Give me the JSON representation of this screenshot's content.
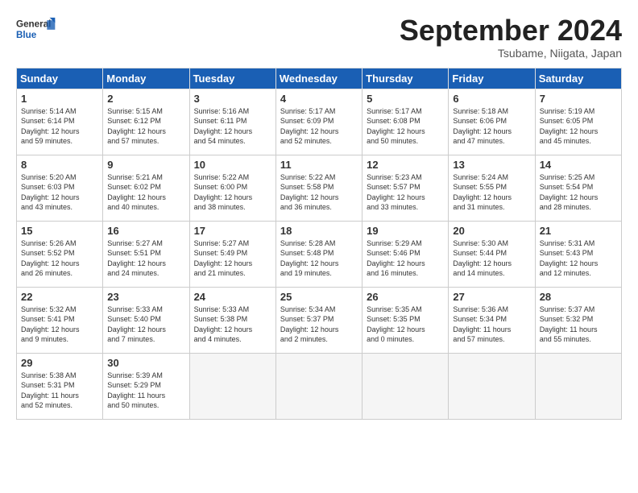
{
  "header": {
    "logo_general": "General",
    "logo_blue": "Blue",
    "month": "September 2024",
    "location": "Tsubame, Niigata, Japan"
  },
  "weekdays": [
    "Sunday",
    "Monday",
    "Tuesday",
    "Wednesday",
    "Thursday",
    "Friday",
    "Saturday"
  ],
  "weeks": [
    [
      {
        "day": "1",
        "info": "Sunrise: 5:14 AM\nSunset: 6:14 PM\nDaylight: 12 hours\nand 59 minutes."
      },
      {
        "day": "2",
        "info": "Sunrise: 5:15 AM\nSunset: 6:12 PM\nDaylight: 12 hours\nand 57 minutes."
      },
      {
        "day": "3",
        "info": "Sunrise: 5:16 AM\nSunset: 6:11 PM\nDaylight: 12 hours\nand 54 minutes."
      },
      {
        "day": "4",
        "info": "Sunrise: 5:17 AM\nSunset: 6:09 PM\nDaylight: 12 hours\nand 52 minutes."
      },
      {
        "day": "5",
        "info": "Sunrise: 5:17 AM\nSunset: 6:08 PM\nDaylight: 12 hours\nand 50 minutes."
      },
      {
        "day": "6",
        "info": "Sunrise: 5:18 AM\nSunset: 6:06 PM\nDaylight: 12 hours\nand 47 minutes."
      },
      {
        "day": "7",
        "info": "Sunrise: 5:19 AM\nSunset: 6:05 PM\nDaylight: 12 hours\nand 45 minutes."
      }
    ],
    [
      {
        "day": "8",
        "info": "Sunrise: 5:20 AM\nSunset: 6:03 PM\nDaylight: 12 hours\nand 43 minutes."
      },
      {
        "day": "9",
        "info": "Sunrise: 5:21 AM\nSunset: 6:02 PM\nDaylight: 12 hours\nand 40 minutes."
      },
      {
        "day": "10",
        "info": "Sunrise: 5:22 AM\nSunset: 6:00 PM\nDaylight: 12 hours\nand 38 minutes."
      },
      {
        "day": "11",
        "info": "Sunrise: 5:22 AM\nSunset: 5:58 PM\nDaylight: 12 hours\nand 36 minutes."
      },
      {
        "day": "12",
        "info": "Sunrise: 5:23 AM\nSunset: 5:57 PM\nDaylight: 12 hours\nand 33 minutes."
      },
      {
        "day": "13",
        "info": "Sunrise: 5:24 AM\nSunset: 5:55 PM\nDaylight: 12 hours\nand 31 minutes."
      },
      {
        "day": "14",
        "info": "Sunrise: 5:25 AM\nSunset: 5:54 PM\nDaylight: 12 hours\nand 28 minutes."
      }
    ],
    [
      {
        "day": "15",
        "info": "Sunrise: 5:26 AM\nSunset: 5:52 PM\nDaylight: 12 hours\nand 26 minutes."
      },
      {
        "day": "16",
        "info": "Sunrise: 5:27 AM\nSunset: 5:51 PM\nDaylight: 12 hours\nand 24 minutes."
      },
      {
        "day": "17",
        "info": "Sunrise: 5:27 AM\nSunset: 5:49 PM\nDaylight: 12 hours\nand 21 minutes."
      },
      {
        "day": "18",
        "info": "Sunrise: 5:28 AM\nSunset: 5:48 PM\nDaylight: 12 hours\nand 19 minutes."
      },
      {
        "day": "19",
        "info": "Sunrise: 5:29 AM\nSunset: 5:46 PM\nDaylight: 12 hours\nand 16 minutes."
      },
      {
        "day": "20",
        "info": "Sunrise: 5:30 AM\nSunset: 5:44 PM\nDaylight: 12 hours\nand 14 minutes."
      },
      {
        "day": "21",
        "info": "Sunrise: 5:31 AM\nSunset: 5:43 PM\nDaylight: 12 hours\nand 12 minutes."
      }
    ],
    [
      {
        "day": "22",
        "info": "Sunrise: 5:32 AM\nSunset: 5:41 PM\nDaylight: 12 hours\nand 9 minutes."
      },
      {
        "day": "23",
        "info": "Sunrise: 5:33 AM\nSunset: 5:40 PM\nDaylight: 12 hours\nand 7 minutes."
      },
      {
        "day": "24",
        "info": "Sunrise: 5:33 AM\nSunset: 5:38 PM\nDaylight: 12 hours\nand 4 minutes."
      },
      {
        "day": "25",
        "info": "Sunrise: 5:34 AM\nSunset: 5:37 PM\nDaylight: 12 hours\nand 2 minutes."
      },
      {
        "day": "26",
        "info": "Sunrise: 5:35 AM\nSunset: 5:35 PM\nDaylight: 12 hours\nand 0 minutes."
      },
      {
        "day": "27",
        "info": "Sunrise: 5:36 AM\nSunset: 5:34 PM\nDaylight: 11 hours\nand 57 minutes."
      },
      {
        "day": "28",
        "info": "Sunrise: 5:37 AM\nSunset: 5:32 PM\nDaylight: 11 hours\nand 55 minutes."
      }
    ],
    [
      {
        "day": "29",
        "info": "Sunrise: 5:38 AM\nSunset: 5:31 PM\nDaylight: 11 hours\nand 52 minutes."
      },
      {
        "day": "30",
        "info": "Sunrise: 5:39 AM\nSunset: 5:29 PM\nDaylight: 11 hours\nand 50 minutes."
      },
      {
        "day": "",
        "info": ""
      },
      {
        "day": "",
        "info": ""
      },
      {
        "day": "",
        "info": ""
      },
      {
        "day": "",
        "info": ""
      },
      {
        "day": "",
        "info": ""
      }
    ]
  ]
}
